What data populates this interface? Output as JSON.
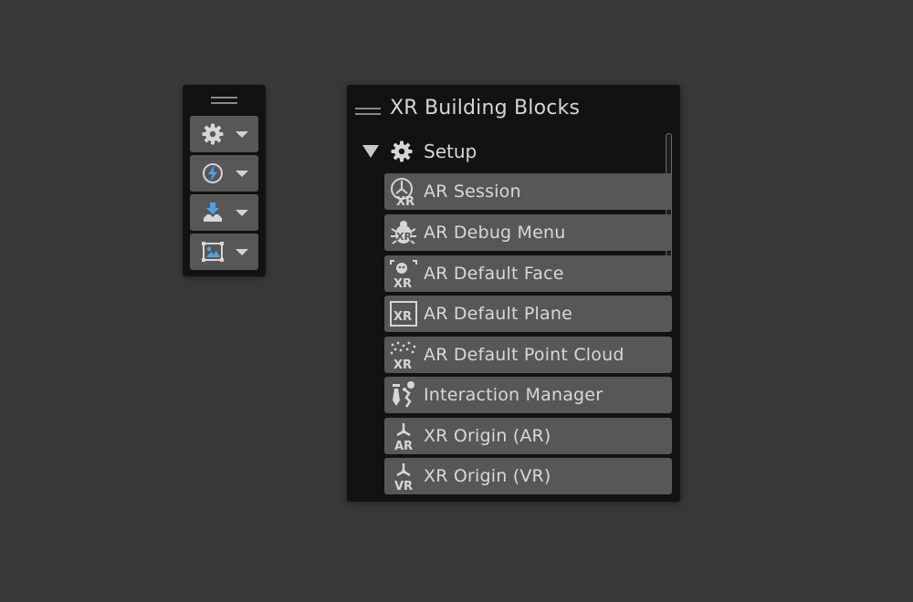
{
  "toolbar": {
    "buttons": [
      {
        "icon": "gear-icon"
      },
      {
        "icon": "lightning-icon"
      },
      {
        "icon": "download-icon"
      },
      {
        "icon": "image-icon"
      }
    ]
  },
  "panel": {
    "title": "XR Building Blocks",
    "section": {
      "label": "Setup",
      "expanded": true,
      "items": [
        {
          "label": "AR Session",
          "icon": "ar-session-icon"
        },
        {
          "label": "AR Debug Menu",
          "icon": "ar-debug-menu-icon"
        },
        {
          "label": "AR Default Face",
          "icon": "ar-default-face-icon"
        },
        {
          "label": "AR Default Plane",
          "icon": "ar-default-plane-icon"
        },
        {
          "label": "AR Default Point Cloud",
          "icon": "ar-point-cloud-icon"
        },
        {
          "label": "Interaction Manager",
          "icon": "interaction-manager-icon"
        },
        {
          "label": "XR Origin (AR)",
          "icon": "xr-origin-ar-icon"
        },
        {
          "label": "XR Origin (VR)",
          "icon": "xr-origin-vr-icon"
        }
      ]
    }
  },
  "icon_text": {
    "xr": "XR",
    "ar": "AR",
    "vr": "VR"
  },
  "colors": {
    "background": "#383838",
    "panel": "#121212",
    "item": "#575757",
    "text": "#d8d8d8",
    "accent_blue": "#4aa3e8"
  }
}
